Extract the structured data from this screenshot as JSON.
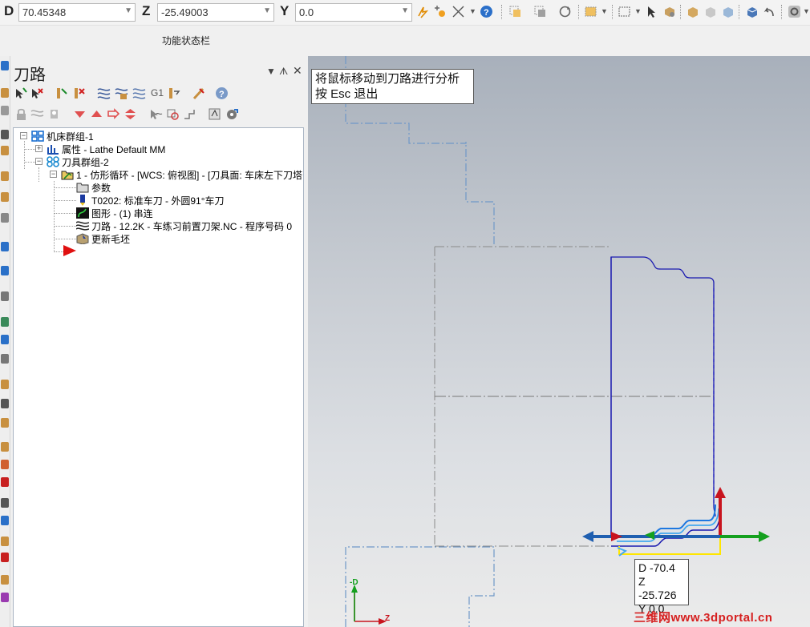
{
  "coords": {
    "d_label": "D",
    "d_value": "70.45348",
    "z_label": "Z",
    "z_value": "-25.49003",
    "y_label": "Y",
    "y_value": "0.0"
  },
  "status_bar": {
    "label": "功能状态栏"
  },
  "toolpath_panel": {
    "title": "刀路",
    "tree": {
      "machine_group": "机床群组-1",
      "properties": "属性 - Lathe Default MM",
      "toolgroup": "刀具群组-2",
      "operation": "1 - 仿形循环 - [WCS: 俯视图] - [刀具面: 车床左下刀塔",
      "parameters": "参数",
      "tool": "T0202: 标准车刀 - 外圆91°车刀",
      "geometry": "图形 - (1) 串连",
      "toolpath": "刀路 - 12.2K - 车练习前置刀架.NC - 程序号码 0",
      "update_stock": "更新毛坯"
    },
    "toolbar_row1_g1": "G1"
  },
  "viewport": {
    "tooltip_line1": "将鼠标移动到刀路进行分析",
    "tooltip_line2": "按 Esc 退出",
    "readout_d": "D -70.4",
    "readout_z": "Z -25.726",
    "readout_y": "Y 0.0",
    "gnomon_d": "-D",
    "gnomon_z": "Z",
    "watermark": "三维网www.3dportal.cn"
  },
  "colors": {
    "toolpath_blue": "#1a1ab0",
    "stock_dash": "#6f98c8",
    "axis_red": "#c8141e",
    "axis_green": "#14a01e",
    "axis_blue": "#1f5fb0",
    "path_yellow": "#ffe600"
  }
}
